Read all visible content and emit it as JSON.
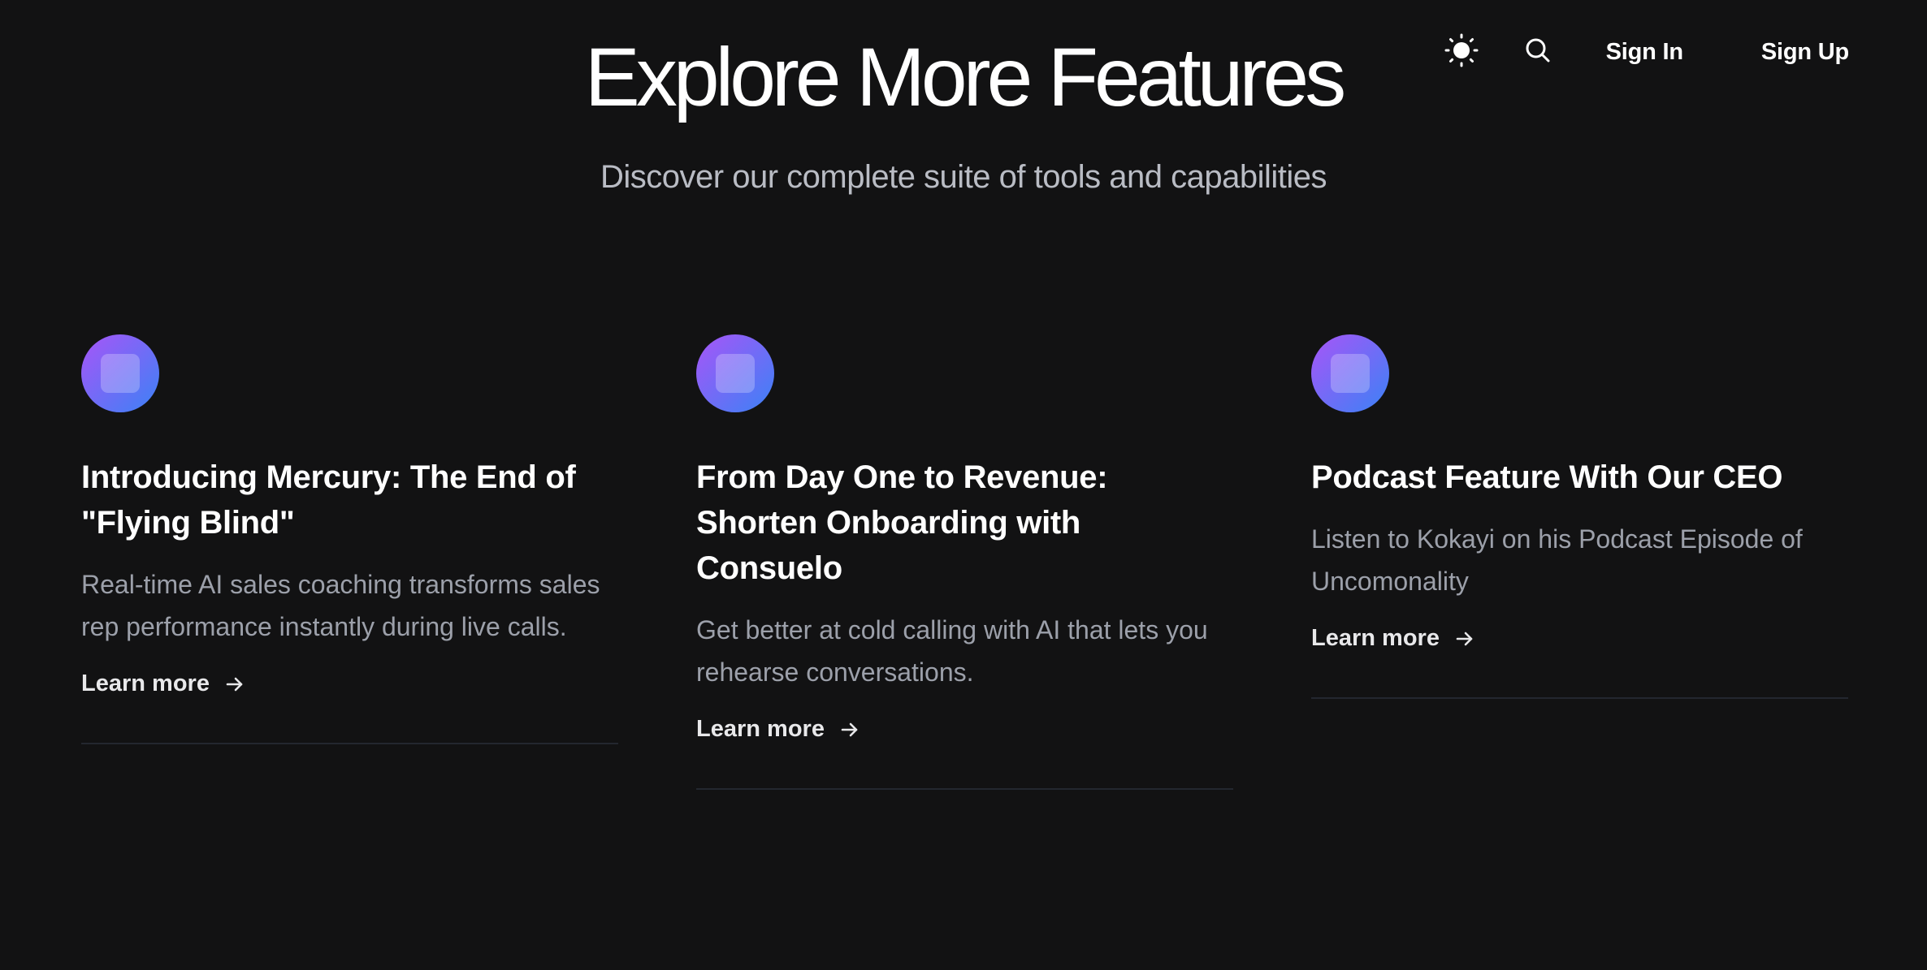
{
  "nav": {
    "theme_icon": "sun-icon",
    "search_icon": "search-icon",
    "sign_in": "Sign In",
    "sign_up": "Sign Up"
  },
  "hero": {
    "title": "Explore More Features",
    "subtitle": "Discover our complete suite of tools and capabilities"
  },
  "colors": {
    "background": "#121213",
    "icon_gradient_start": "#a855f7",
    "icon_gradient_end": "#3b82f6",
    "muted_text": "#9ca0aa"
  },
  "cards": [
    {
      "icon": "feature-icon",
      "title": "Introducing Mercury: The End of \"Flying Blind\"",
      "description": "Real-time AI sales coaching transforms sales rep performance instantly during live calls.",
      "link": "Learn more",
      "link_icon": "arrow-right-icon"
    },
    {
      "icon": "feature-icon",
      "title": "From Day One to Revenue: Shorten Onboarding with Consuelo",
      "description": "Get better at cold calling with AI that lets you rehearse conversations.",
      "link": "Learn more",
      "link_icon": "arrow-right-icon"
    },
    {
      "icon": "feature-icon",
      "title": "Podcast Feature With Our CEO",
      "description": "Listen to Kokayi on his Podcast Episode of Uncomonality",
      "link": "Learn more",
      "link_icon": "arrow-right-icon"
    }
  ]
}
